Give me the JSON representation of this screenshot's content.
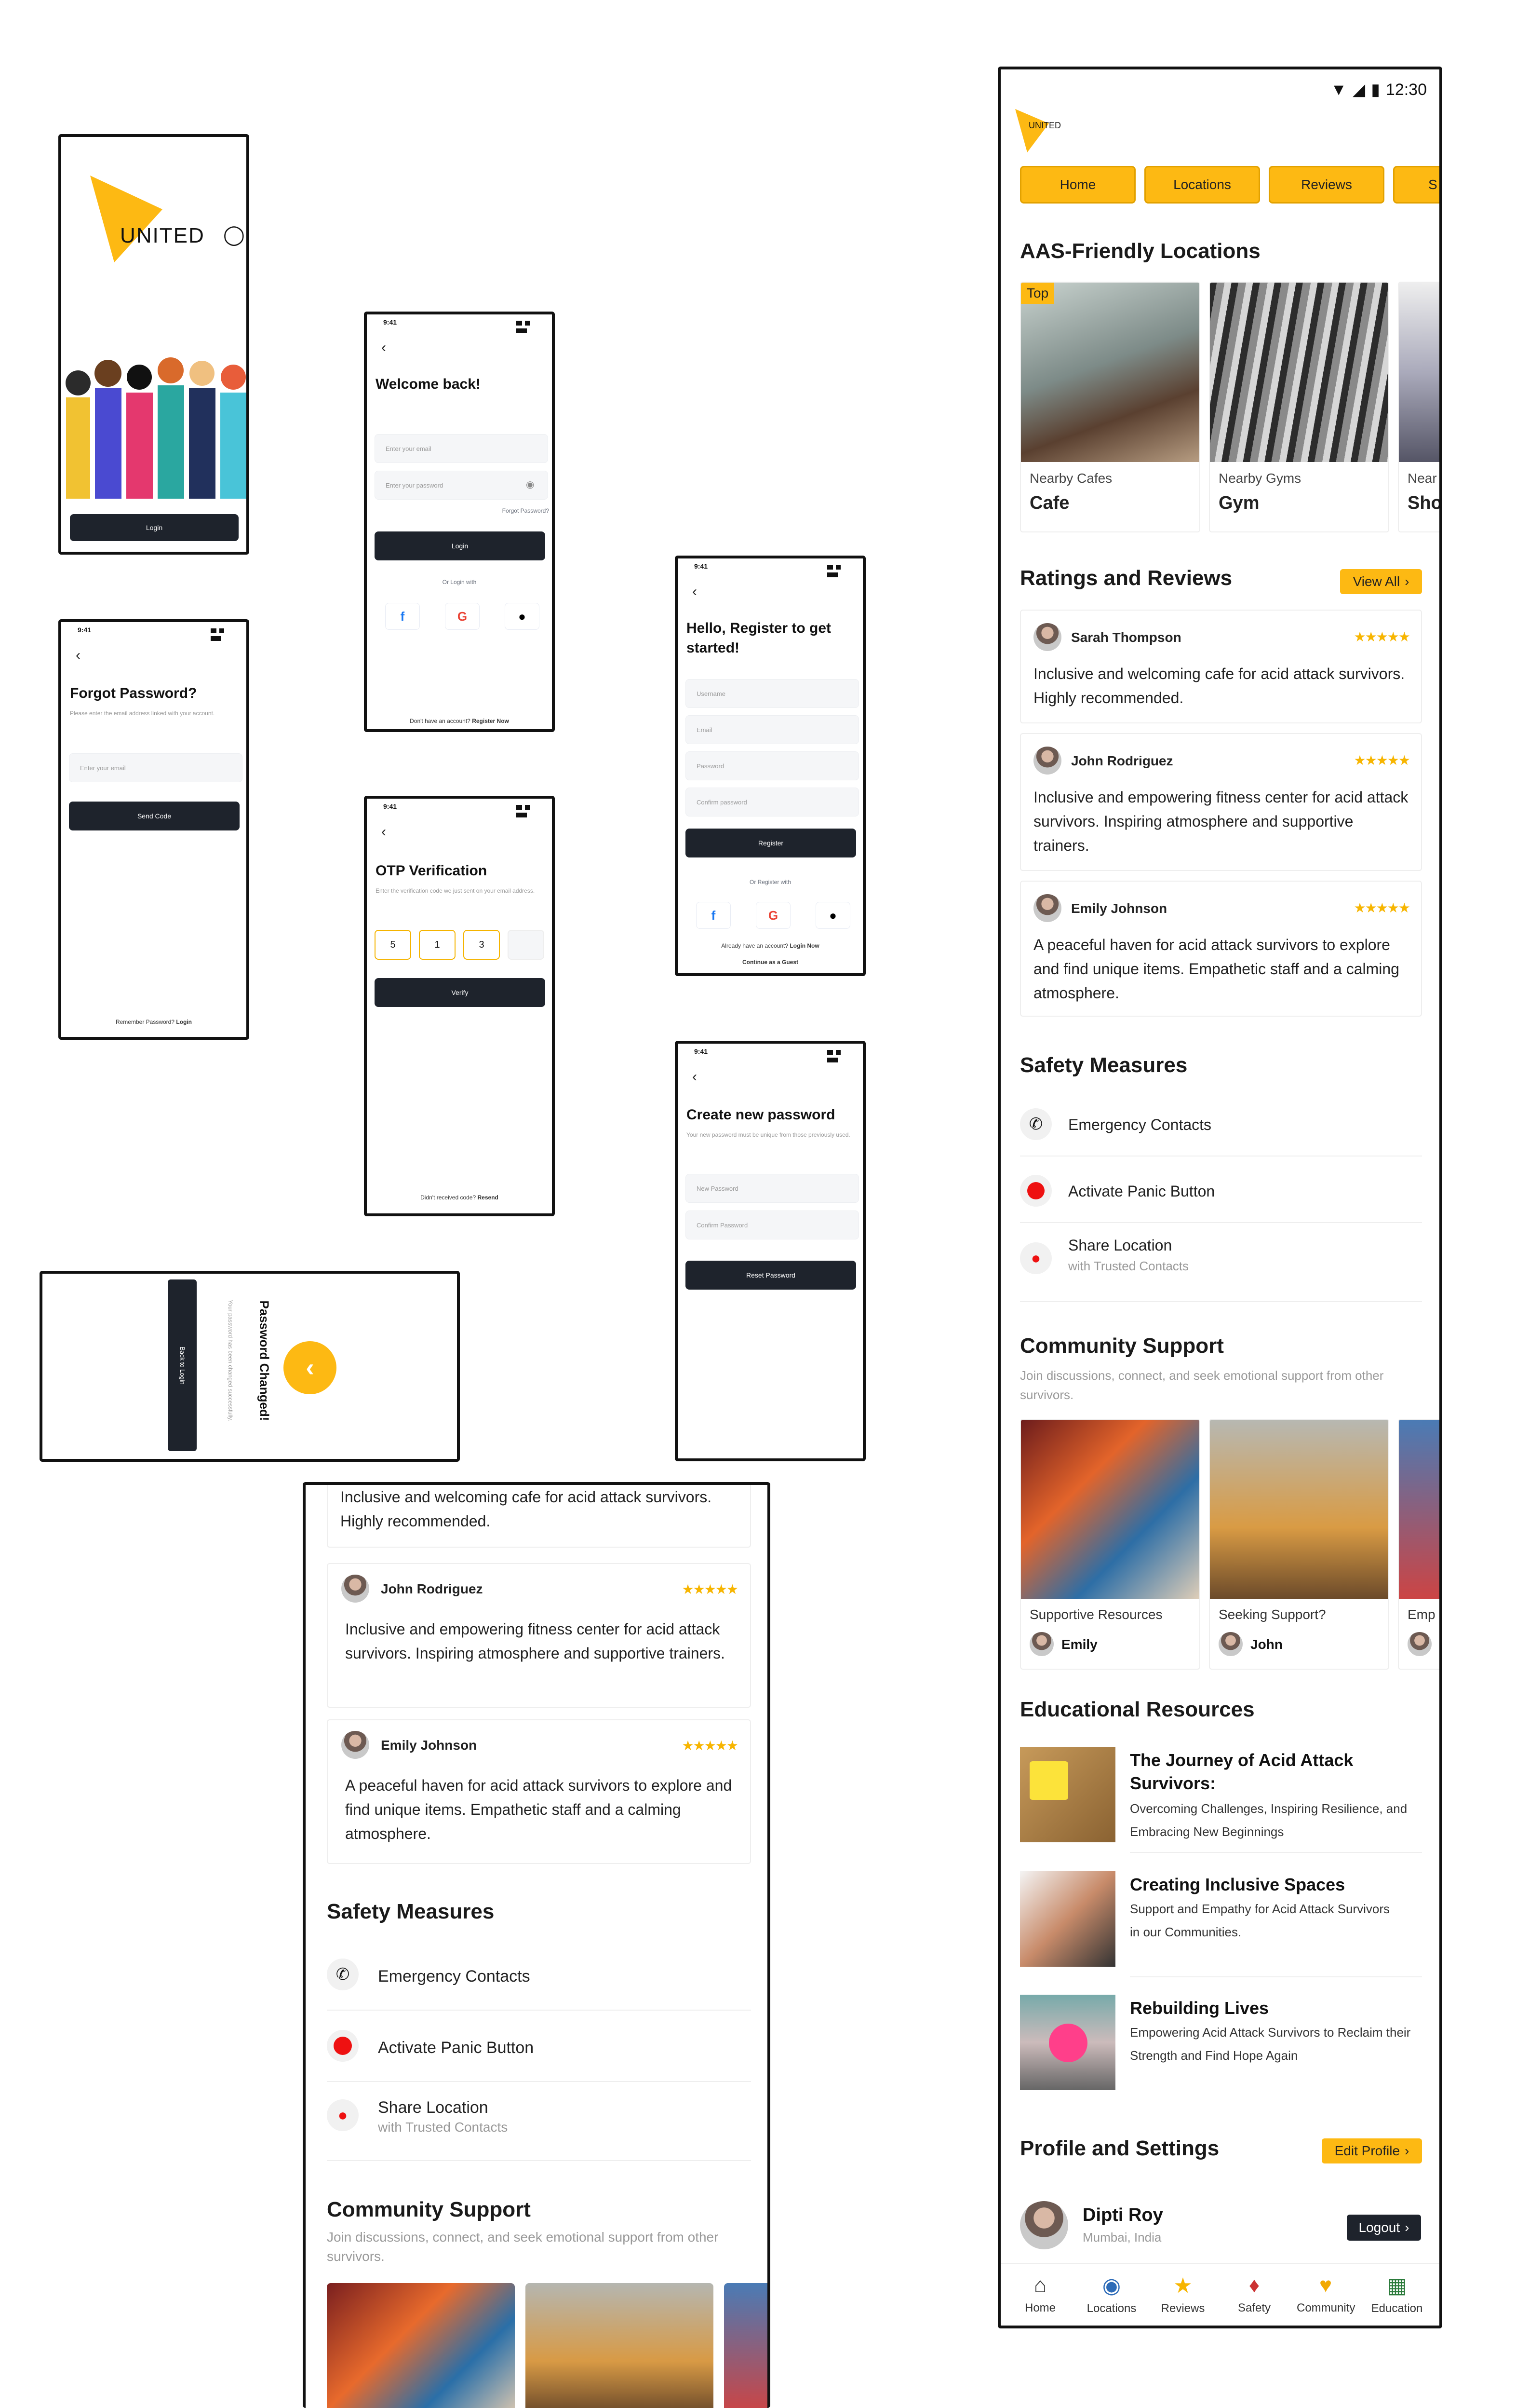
{
  "splash": {
    "brand": "UNITED",
    "login_btn": "Login"
  },
  "login": {
    "time": "9:41",
    "title": "Welcome back!",
    "email_ph": "Enter your email",
    "pwd_ph": "Enter your password",
    "forgot": "Forgot Password?",
    "login_btn": "Login",
    "or": "Or Login with",
    "no_account": "Don't have an account?",
    "register_now": "Register Now"
  },
  "register": {
    "time": "9:41",
    "title": "Hello, Register to get started!",
    "username": "Username",
    "email": "Email",
    "password": "Password",
    "confirm": "Confirm password",
    "register_btn": "Register",
    "or": "Or Register with",
    "have_account": "Already have an account?",
    "login_now": "Login Now",
    "guest": "Continue as a Guest"
  },
  "forgot": {
    "time": "9:41",
    "title": "Forgot Password?",
    "sub": "Please enter the email address linked with your account.",
    "email_ph": "Enter your email",
    "send_btn": "Send Code",
    "remember": "Remember Password?",
    "login": "Login"
  },
  "otp": {
    "time": "9:41",
    "title": "OTP Verification",
    "sub": "Enter the verification code we just sent on your email address.",
    "d1": "5",
    "d2": "1",
    "d3": "3",
    "d4": "",
    "verify_btn": "Verify",
    "no_code": "Didn't received code?",
    "resend": "Resend"
  },
  "newpwd": {
    "time": "9:41",
    "title": "Create new password",
    "sub": "Your new password must be unique from those previously used.",
    "new_ph": "New Password",
    "confirm_ph": "Confirm Password",
    "reset_btn": "Reset Password"
  },
  "changed": {
    "title": "Password Changed!",
    "sub": "Your password has been changed successfully.",
    "back_btn": "Back to Login"
  },
  "main": {
    "status_time": "12:30",
    "brand": "UNITED",
    "tabs": [
      "Home",
      "Locations",
      "Reviews",
      "S"
    ],
    "aas_title": "AAS-Friendly Locations",
    "top_badge": "Top",
    "locations": [
      {
        "sub": "Nearby Cafes",
        "name": "Cafe"
      },
      {
        "sub": "Nearby Gyms",
        "name": "Gym"
      },
      {
        "sub": "Near",
        "name": "Sho"
      }
    ],
    "ratings_title": "Ratings and Reviews",
    "view_all": "View All",
    "reviews": [
      {
        "name": "Sarah Thompson",
        "stars": "★★★★★",
        "text": "Inclusive and welcoming cafe for acid attack survivors. Highly recommended."
      },
      {
        "name": "John Rodriguez",
        "stars": "★★★★★",
        "text": "Inclusive and empowering fitness center for acid attack survivors. Inspiring atmosphere and supportive trainers."
      },
      {
        "name": "Emily Johnson",
        "stars": "★★★★★",
        "text": "A peaceful haven for acid attack survivors to explore and find unique items. Empathetic staff and a calming atmosphere."
      }
    ],
    "safety_title": "Safety Measures",
    "safety": [
      {
        "label": "Emergency Contacts",
        "sub": ""
      },
      {
        "label": "Activate Panic Button",
        "sub": ""
      },
      {
        "label": "Share Location",
        "sub": "with Trusted Contacts"
      }
    ],
    "community_title": "Community Support",
    "community_sub": "Join discussions, connect, and seek emotional support from other survivors.",
    "community": [
      {
        "title": "Supportive Resources",
        "user": "Emily"
      },
      {
        "title": "Seeking Support?",
        "user": "John"
      },
      {
        "title": "Emp",
        "user": ""
      }
    ],
    "edu_title": "Educational Resources",
    "edu": [
      {
        "title": "The Journey of Acid Attack Survivors:",
        "text": "Overcoming Challenges, Inspiring Resilience, and Embracing New Beginnings"
      },
      {
        "title": "Creating Inclusive Spaces",
        "text": "Support and Empathy for Acid Attack Survivors in our Communities."
      },
      {
        "title": "Rebuilding Lives",
        "text": "Empowering Acid Attack Survivors to Reclaim their Strength and Find Hope Again"
      }
    ],
    "profile_title": "Profile and Settings",
    "edit_profile": "Edit Profile",
    "user_name": "Dipti Roy",
    "user_loc": "Mumbai, India",
    "logout": "Logout",
    "nav": [
      "Home",
      "Locations",
      "Reviews",
      "Safety",
      "Community",
      "Education"
    ]
  },
  "scroll": {
    "review0_text": "Inclusive and welcoming cafe for acid attack survivors. Highly recommended.",
    "reviews": [
      {
        "name": "John Rodriguez",
        "stars": "★★★★★",
        "text": "Inclusive and empowering fitness center for acid attack survivors. Inspiring atmosphere and supportive trainers."
      },
      {
        "name": "Emily Johnson",
        "stars": "★★★★★",
        "text": "A peaceful haven for acid attack survivors to explore and find unique items. Empathetic staff and a calming atmosphere."
      }
    ],
    "safety_title": "Safety Measures",
    "safety": [
      {
        "label": "Emergency Contacts",
        "sub": ""
      },
      {
        "label": "Activate Panic Button",
        "sub": ""
      },
      {
        "label": "Share Location",
        "sub": "with Trusted Contacts"
      }
    ],
    "community_title": "Community Support",
    "community_sub": "Join discussions, connect, and seek emotional support from other survivors."
  }
}
